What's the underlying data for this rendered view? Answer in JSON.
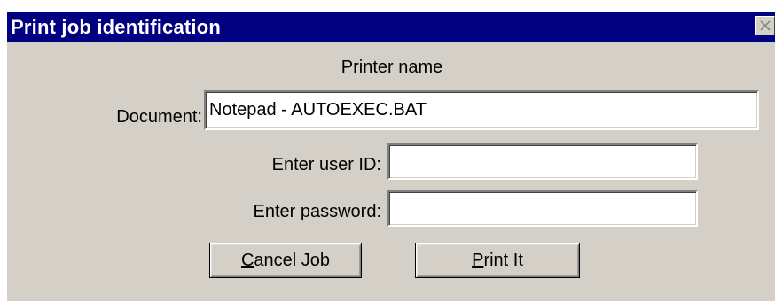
{
  "window": {
    "title": "Print job identification",
    "close_icon": "close-icon",
    "titlebar_color": "#000080",
    "face_color": "#d4d0c8"
  },
  "dialog": {
    "printer_name": "Printer name",
    "document_label": "Document:",
    "document_value": "Notepad - AUTOEXEC.BAT",
    "user_id_label": "Enter user ID:",
    "user_id_value": "",
    "password_label": "Enter password:",
    "password_value": ""
  },
  "buttons": {
    "cancel": {
      "mnemonic": "C",
      "rest": "ancel Job"
    },
    "print": {
      "mnemonic": "P",
      "rest": "rint It"
    }
  }
}
